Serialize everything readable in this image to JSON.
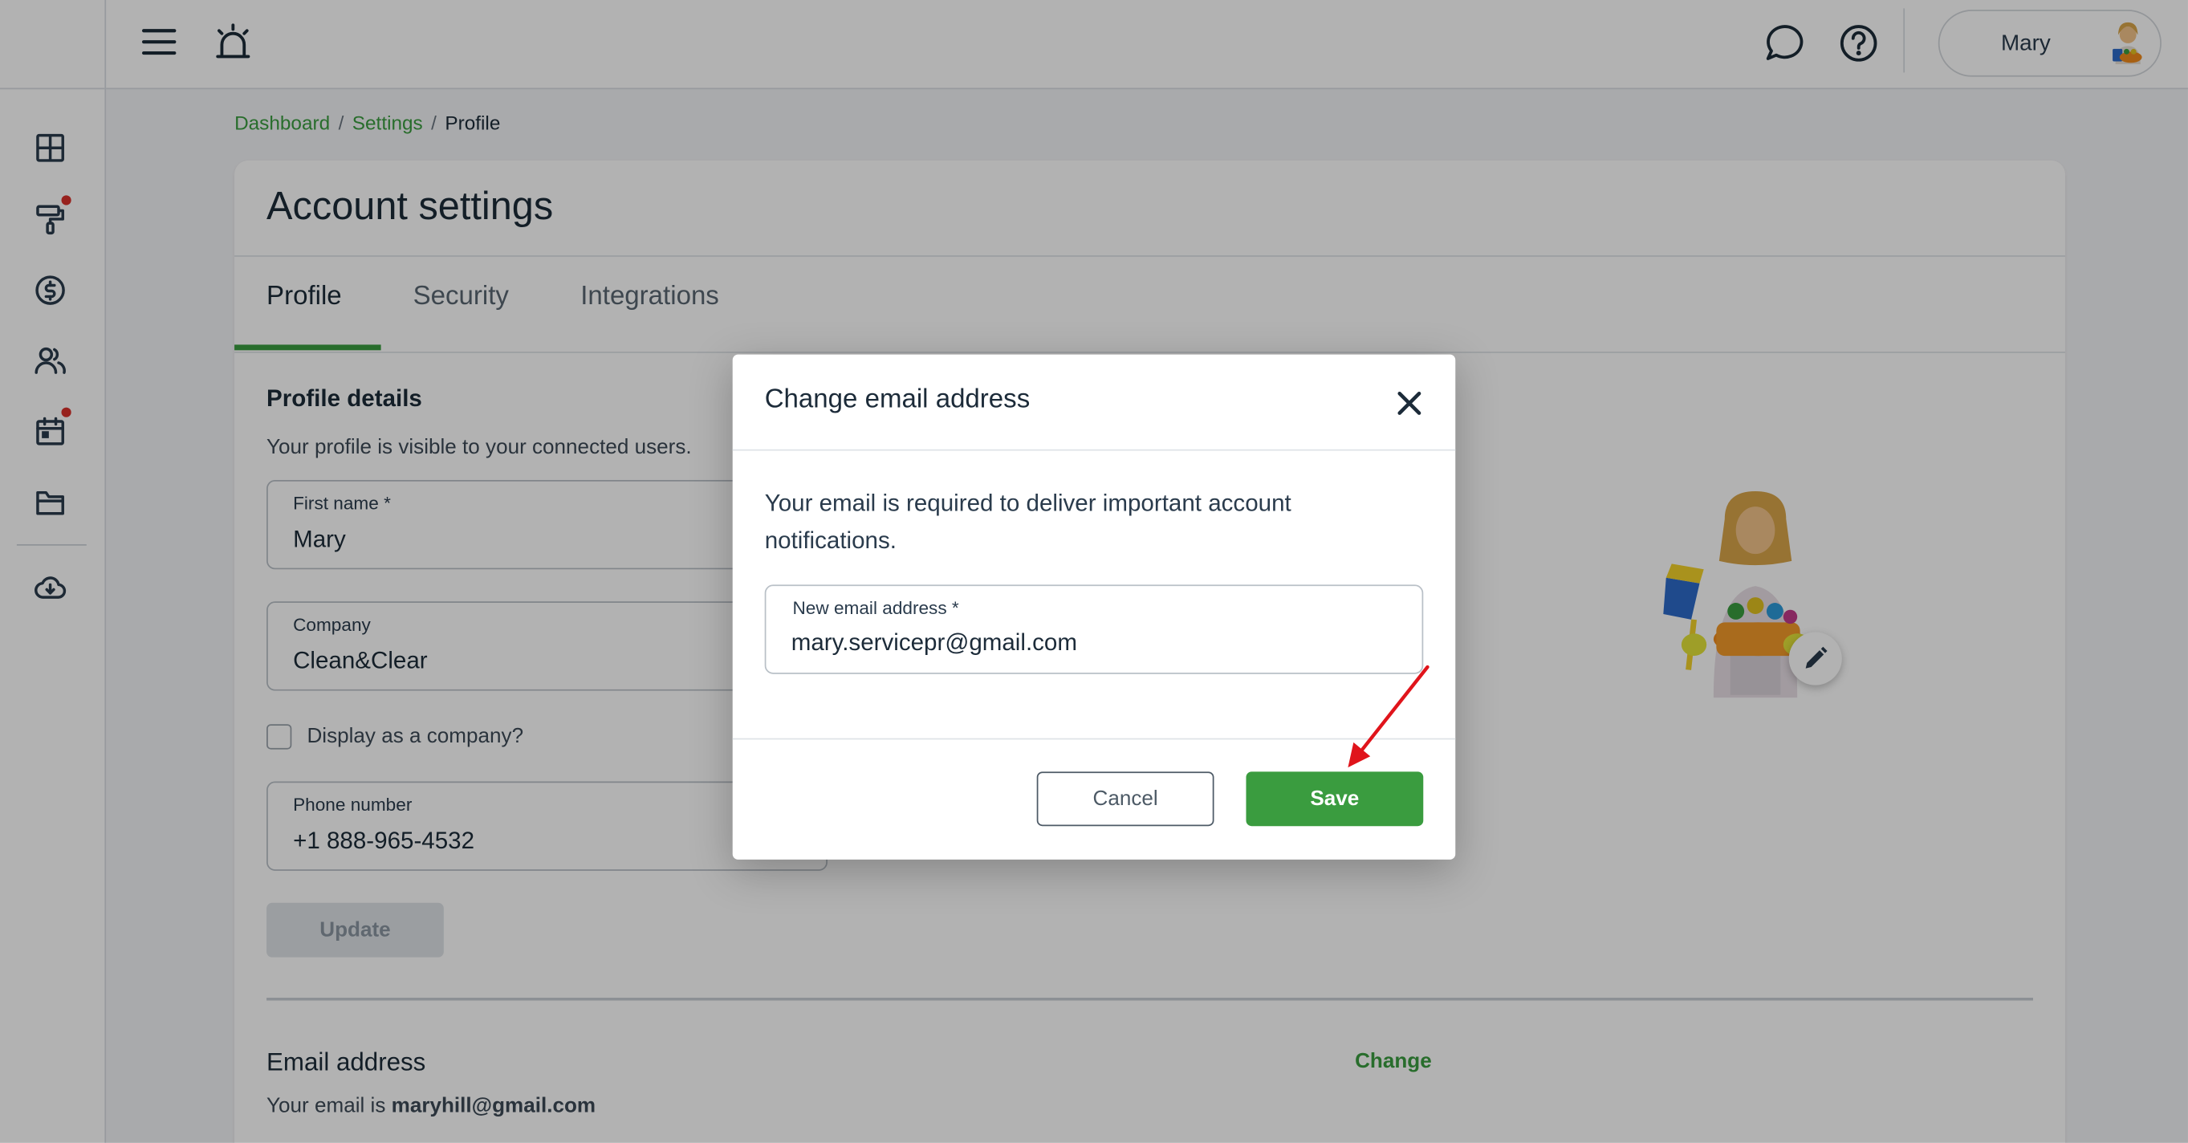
{
  "user": {
    "name": "Mary"
  },
  "breadcrumb": {
    "items": [
      "Dashboard",
      "Settings"
    ],
    "current": "Profile",
    "separator": "/"
  },
  "page": {
    "title": "Account settings",
    "tabs": [
      "Profile",
      "Security",
      "Integrations"
    ],
    "active_tab": "Profile"
  },
  "profile": {
    "title": "Profile details",
    "subtitle": "Your profile is visible to your connected users.",
    "first_name_label": "First name *",
    "first_name": "Mary",
    "company_label": "Company",
    "company": "Clean&Clear",
    "display_company_label": "Display as a company?",
    "phone_label": "Phone number",
    "phone": "+1 888-965-4532",
    "update_label": "Update"
  },
  "email_section": {
    "title": "Email address",
    "prefix": "Your email is",
    "email": "maryhill@gmail.com",
    "change_label": "Change"
  },
  "modal": {
    "title": "Change email address",
    "description": "Your email is required to deliver important account notifications.",
    "field_label": "New email address *",
    "field_value": "mary.servicepr@gmail.com",
    "cancel_label": "Cancel",
    "save_label": "Save"
  },
  "sidebar_icons": [
    "dashboard-icon",
    "paint-roller-icon",
    "dollar-icon",
    "users-icon",
    "calendar-icon",
    "folder-icon",
    "cloud-download-icon"
  ],
  "colors": {
    "accent": "#3a9c3f",
    "text": "#1c2b39",
    "notification": "#d9322b",
    "annotation_arrow": "#e0141b"
  }
}
